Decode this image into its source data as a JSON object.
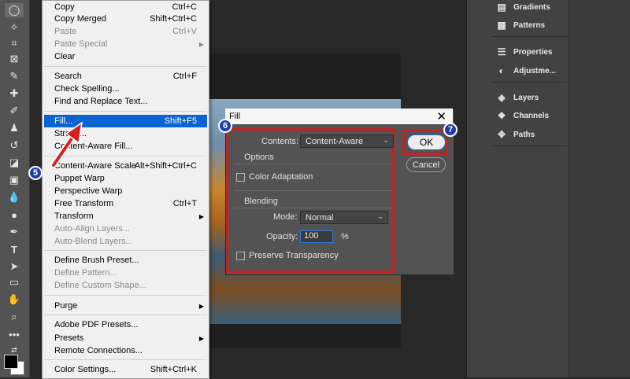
{
  "menu": {
    "items": [
      {
        "label": "Copy",
        "shortcut": "Ctrl+C"
      },
      {
        "label": "Copy Merged",
        "shortcut": "Shift+Ctrl+C"
      },
      {
        "label": "Paste",
        "shortcut": "Ctrl+V"
      },
      {
        "label": "Paste Special",
        "shortcut": ""
      },
      {
        "label": "Clear",
        "shortcut": ""
      },
      {
        "label": "Search",
        "shortcut": "Ctrl+F"
      },
      {
        "label": "Check Spelling...",
        "shortcut": ""
      },
      {
        "label": "Find and Replace Text...",
        "shortcut": ""
      },
      {
        "label": "Fill...",
        "shortcut": "Shift+F5"
      },
      {
        "label": "Stroke...",
        "shortcut": ""
      },
      {
        "label": "Content-Aware Fill...",
        "shortcut": ""
      },
      {
        "label": "Content-Aware Scale",
        "shortcut": "Alt+Shift+Ctrl+C"
      },
      {
        "label": "Puppet Warp",
        "shortcut": ""
      },
      {
        "label": "Perspective Warp",
        "shortcut": ""
      },
      {
        "label": "Free Transform",
        "shortcut": "Ctrl+T"
      },
      {
        "label": "Transform",
        "shortcut": ""
      },
      {
        "label": "Auto-Align Layers...",
        "shortcut": ""
      },
      {
        "label": "Auto-Blend Layers...",
        "shortcut": ""
      },
      {
        "label": "Define Brush Preset...",
        "shortcut": ""
      },
      {
        "label": "Define Pattern...",
        "shortcut": ""
      },
      {
        "label": "Define Custom Shape...",
        "shortcut": ""
      },
      {
        "label": "Purge",
        "shortcut": ""
      },
      {
        "label": "Adobe PDF Presets...",
        "shortcut": ""
      },
      {
        "label": "Presets",
        "shortcut": ""
      },
      {
        "label": "Remote Connections...",
        "shortcut": ""
      },
      {
        "label": "Color Settings...",
        "shortcut": "Shift+Ctrl+K"
      }
    ]
  },
  "panels": {
    "items": [
      {
        "label": "Gradients",
        "icon": "gradient-icon"
      },
      {
        "label": "Patterns",
        "icon": "pattern-icon"
      },
      {
        "label": "Properties",
        "icon": "properties-icon"
      },
      {
        "label": "Adjustme...",
        "icon": "adjustments-icon"
      },
      {
        "label": "Layers",
        "icon": "layers-icon"
      },
      {
        "label": "Channels",
        "icon": "channels-icon"
      },
      {
        "label": "Paths",
        "icon": "paths-icon"
      }
    ]
  },
  "dialog": {
    "title": "Fill",
    "contents_label": "Contents:",
    "contents_value": "Content-Aware",
    "options_label": "Options",
    "color_adaptation_label": "Color Adaptation",
    "blending_label": "Blending",
    "mode_label": "Mode:",
    "mode_value": "Normal",
    "opacity_label": "Opacity:",
    "opacity_value": "100",
    "opacity_unit": "%",
    "preserve_label": "Preserve Transparency",
    "ok_label": "OK",
    "cancel_label": "Cancel"
  },
  "badges": {
    "step5": "5",
    "step6": "6",
    "step7": "7"
  },
  "colors": {
    "highlight": "#c22222",
    "selection": "#0a64d2",
    "badge": "#1b3fa8"
  }
}
